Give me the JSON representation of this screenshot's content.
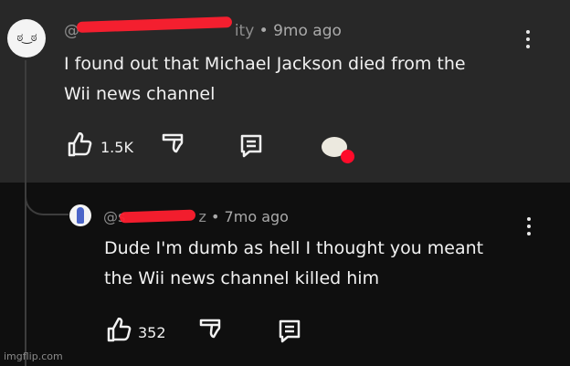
{
  "comment": {
    "handle_prefix": "@",
    "handle_suffix": "ity",
    "time": "• 9mo ago",
    "text_line_1": "I found out that Michael Jackson died from the",
    "text_line_2": "Wii news channel",
    "likes": "1.5K",
    "avatar_text": "ಠ‿ಠ"
  },
  "reply": {
    "handle_prefix": "@s",
    "handle_suffix": "z",
    "time": "• 7mo ago",
    "text_line_1": "Dude I'm dumb as hell I thought you meant",
    "text_line_2": "the Wii news channel killed him",
    "likes": "352"
  },
  "watermark": "imgflip.com",
  "colors": {
    "top_background": "#282828",
    "bottom_background": "#0f0f0f",
    "redaction": "#ff1f2f",
    "text": "#f1f1f1"
  }
}
